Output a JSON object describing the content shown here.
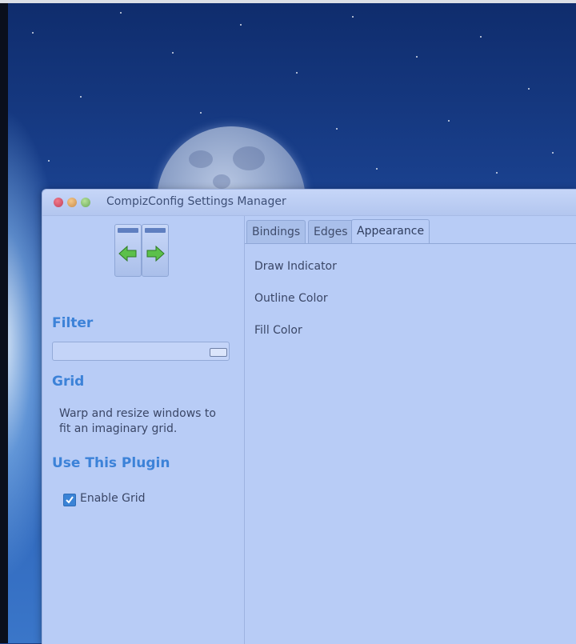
{
  "window": {
    "title": "CompizConfig Settings Manager"
  },
  "sidebar": {
    "filter_heading": "Filter",
    "filter_value": "",
    "plugin_heading": "Grid",
    "plugin_description": "Warp and resize windows to fit an imaginary grid.",
    "use_heading": "Use This Plugin",
    "enable_label": "Enable Grid",
    "enable_checked": true
  },
  "tabs": [
    {
      "label": "Bindings",
      "active": false
    },
    {
      "label": "Edges",
      "active": false
    },
    {
      "label": "Appearance",
      "active": true
    }
  ],
  "appearance_options": [
    {
      "label": "Draw Indicator"
    },
    {
      "label": "Outline Color"
    },
    {
      "label": "Fill Color"
    }
  ],
  "colors": {
    "accent": "#3c82d8",
    "window_bg": "#b8ccf6",
    "close": "#d9506a",
    "minimize": "#e0a05a",
    "maximize": "#86c06a"
  },
  "icons": {
    "back": "arrow-left-icon",
    "forward": "arrow-right-icon",
    "clear": "clear-field-icon",
    "checkbox": "checkmark-icon"
  }
}
